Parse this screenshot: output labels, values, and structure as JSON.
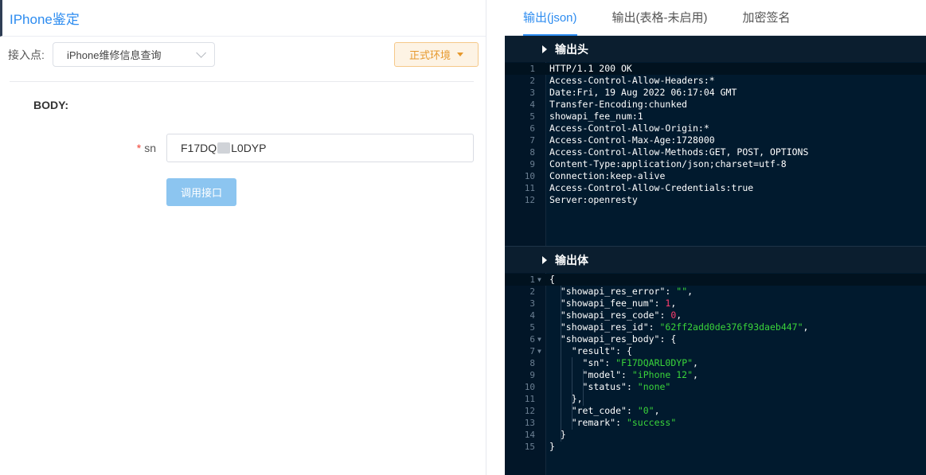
{
  "left": {
    "title": "IPhone鉴定",
    "entry_label": "接入点:",
    "entry_value": "iPhone维修信息查询",
    "env_button": "正式环境",
    "body_label": "BODY:",
    "sn_label": "sn",
    "sn_value_prefix": "F17DQ",
    "sn_value_suffix": "L0DYP",
    "call_button": "调用接口"
  },
  "right": {
    "tabs": [
      "输出(json)",
      "输出(表格-未启用)",
      "加密签名"
    ],
    "header_section": "输出头",
    "body_section": "输出体",
    "header_lines": [
      "HTTP/1.1 200 OK",
      "Access-Control-Allow-Headers:*",
      "Date:Fri, 19 Aug 2022 06:17:04 GMT",
      "Transfer-Encoding:chunked",
      "showapi_fee_num:1",
      "Access-Control-Allow-Origin:*",
      "Access-Control-Max-Age:1728000",
      "Access-Control-Allow-Methods:GET, POST, OPTIONS",
      "Content-Type:application/json;charset=utf-8",
      "Connection:keep-alive",
      "Access-Control-Allow-Credentials:true",
      "Server:openresty"
    ],
    "body_lines": [
      "{",
      "  \"showapi_res_error\": \"\",",
      "  \"showapi_fee_num\": 1,",
      "  \"showapi_res_code\": 0,",
      "  \"showapi_res_id\": \"62ff2add0de376f93daeb447\",",
      "  \"showapi_res_body\": {",
      "    \"result\": {",
      "      \"sn\": \"F17DQARL0DYP\",",
      "      \"model\": \"iPhone 12\",",
      "      \"status\": \"none\"",
      "    },",
      "    \"ret_code\": \"0\",",
      "    \"remark\": \"success\"",
      "  }",
      "}"
    ],
    "fold_lines": [
      1,
      6,
      7
    ]
  }
}
